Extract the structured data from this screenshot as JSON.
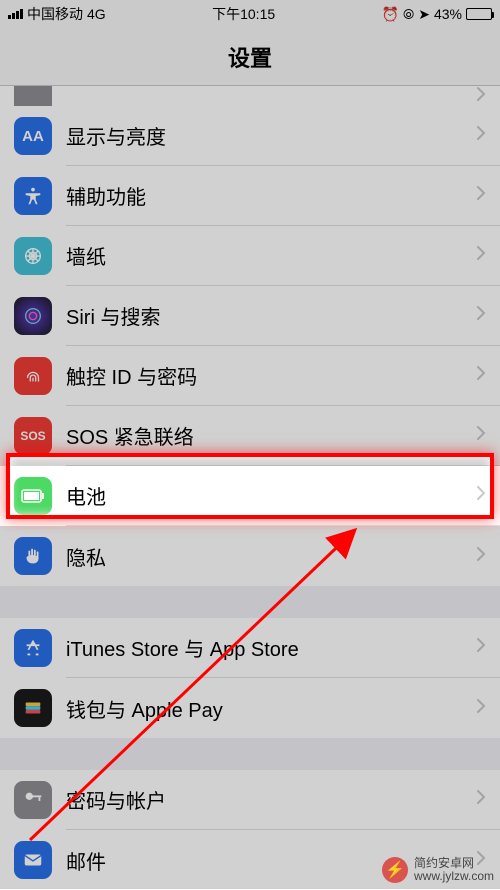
{
  "statusbar": {
    "carrier": "中国移动",
    "network": "4G",
    "time": "下午10:15",
    "alarm_icon": "⏰",
    "lock_icon": "⦾",
    "location_icon": "➤",
    "battery_pct": "43%"
  },
  "navbar": {
    "title": "设置"
  },
  "rows": {
    "display": {
      "label": "显示与亮度",
      "icon_text": "AA",
      "icon_bg": "#2a6fe8"
    },
    "accessibility": {
      "label": "辅助功能",
      "icon_bg": "#2a6fe8"
    },
    "wallpaper": {
      "label": "墙纸",
      "icon_bg": "#45c1d6"
    },
    "siri": {
      "label": "Siri 与搜索",
      "icon_bg": "#1a1a1a"
    },
    "touchid": {
      "label": "触控 ID 与密码",
      "icon_bg": "#ef3b36"
    },
    "sos": {
      "label": "SOS 紧急联络",
      "icon_text": "SOS",
      "icon_bg": "#ef3b36"
    },
    "battery": {
      "label": "电池",
      "icon_bg": "#4cd964"
    },
    "privacy": {
      "label": "隐私",
      "icon_bg": "#2a6fe8"
    },
    "itunes": {
      "label": "iTunes Store 与 App Store",
      "icon_bg": "#2a6fe8"
    },
    "wallet": {
      "label": "钱包与 Apple Pay",
      "icon_bg": "#1a1a1a"
    },
    "passwords": {
      "label": "密码与帐户",
      "icon_bg": "#8e8e93"
    },
    "mail": {
      "label": "邮件",
      "icon_bg": "#2a6fe8"
    }
  },
  "annotation": {
    "highlight_target": "battery",
    "arrow_color": "#ff0000"
  },
  "watermark": {
    "line1": "简约安卓网",
    "line2": "www.jylzw.com"
  }
}
